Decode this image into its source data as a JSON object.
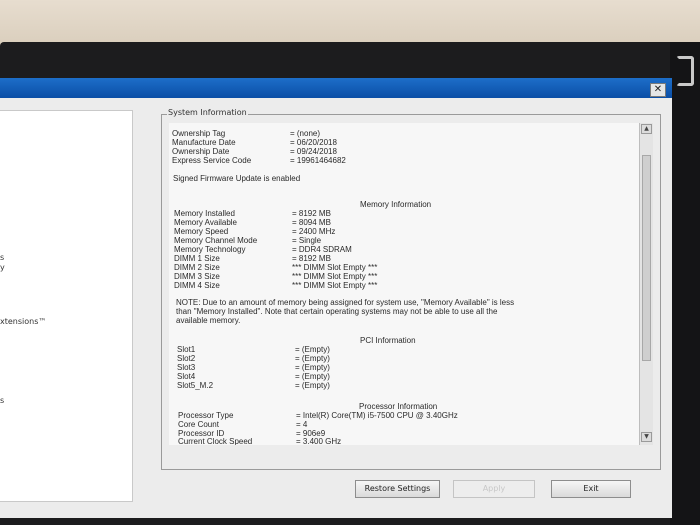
{
  "window": {
    "close_glyph": "✕"
  },
  "left_panel": {
    "items": [
      {
        "label": "s"
      },
      {
        "label": "y"
      },
      {
        "label": "xtensions™"
      },
      {
        "label": "s"
      }
    ]
  },
  "system_info": {
    "group_label": "System Information",
    "ownership": [
      {
        "label": "Ownership Tag",
        "value": "= (none)"
      },
      {
        "label": "Manufacture Date",
        "value": "= 06/20/2018"
      },
      {
        "label": "Ownership Date",
        "value": "= 09/24/2018"
      },
      {
        "label": "Express Service Code",
        "value": "= 19961464682"
      }
    ],
    "signed_firmware": "Signed Firmware Update is enabled",
    "memory": {
      "heading": "Memory Information",
      "rows": [
        {
          "label": "Memory Installed",
          "value": "= 8192 MB"
        },
        {
          "label": "Memory Available",
          "value": "= 8094 MB"
        },
        {
          "label": "Memory Speed",
          "value": "= 2400 MHz"
        },
        {
          "label": "Memory Channel Mode",
          "value": "= Single"
        },
        {
          "label": "Memory Technology",
          "value": "= DDR4 SDRAM"
        },
        {
          "label": "DIMM 1 Size",
          "value": "= 8192 MB"
        },
        {
          "label": "DIMM 2 Size",
          "value": "*** DIMM Slot Empty ***"
        },
        {
          "label": "DIMM 3 Size",
          "value": "*** DIMM Slot Empty ***"
        },
        {
          "label": "DIMM 4 Size",
          "value": "*** DIMM Slot Empty ***"
        }
      ],
      "note_line1": "NOTE: Due to an amount of memory being assigned for system use, \"Memory Available\" is less",
      "note_line2": "than \"Memory Installed\". Note that certain operating systems may not be able to use all the",
      "note_line3": "available memory."
    },
    "pci": {
      "heading": "PCI Information",
      "rows": [
        {
          "label": "Slot1",
          "value": "= (Empty)"
        },
        {
          "label": "Slot2",
          "value": "= (Empty)"
        },
        {
          "label": "Slot3",
          "value": "= (Empty)"
        },
        {
          "label": "Slot4",
          "value": "= (Empty)"
        },
        {
          "label": "Slot5_M.2",
          "value": "= (Empty)"
        }
      ]
    },
    "processor": {
      "heading": "Processor Information",
      "rows": [
        {
          "label": "Processor Type",
          "value": "= Intel(R) Core(TM) i5-7500 CPU @ 3.40GHz"
        },
        {
          "label": "Core Count",
          "value": "= 4"
        },
        {
          "label": "Processor ID",
          "value": "= 906e9"
        },
        {
          "label": "Current Clock Speed",
          "value": "= 3.400 GHz"
        }
      ]
    }
  },
  "scrollbar": {
    "up_glyph": "▲",
    "down_glyph": "▼"
  },
  "buttons": {
    "restore": "Restore Settings",
    "apply": "Apply",
    "exit": "Exit"
  }
}
